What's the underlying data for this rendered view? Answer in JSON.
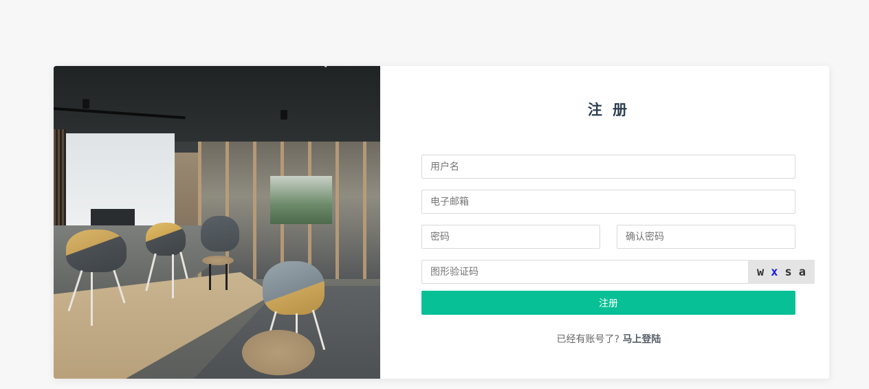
{
  "form": {
    "title": "注 册",
    "username_placeholder": "用户名",
    "email_placeholder": "电子邮箱",
    "password_placeholder": "密码",
    "confirm_password_placeholder": "确认密码",
    "captcha_placeholder": "图形验证码",
    "captcha_chars": [
      {
        "char": "w",
        "color": "#333333"
      },
      {
        "char": "x",
        "color": "#1a1ae6"
      },
      {
        "char": "s",
        "color": "#333333"
      },
      {
        "char": "a",
        "color": "#333333"
      }
    ],
    "submit_label": "注册",
    "login_prompt": "已经有账号了?",
    "login_link": "马上登陆"
  },
  "colors": {
    "page_background": "#f7f7f7",
    "accent": "#07c096",
    "title": "#2c3e50"
  }
}
